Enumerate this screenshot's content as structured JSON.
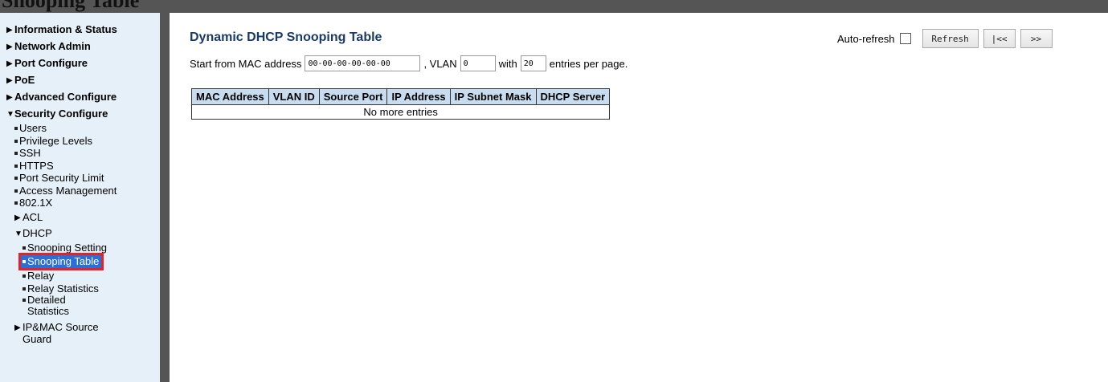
{
  "topbar": {
    "partial_title": "Snooping Table"
  },
  "sidebar": {
    "top_items": [
      {
        "label": "Information & Status"
      },
      {
        "label": "Network Admin"
      },
      {
        "label": "Port Configure"
      },
      {
        "label": "PoE"
      },
      {
        "label": "Advanced Configure"
      },
      {
        "label": "Security Configure"
      }
    ],
    "security_items": [
      "Users",
      "Privilege Levels",
      "SSH",
      "HTTPS",
      "Port Security Limit",
      "Access Management",
      "802.1X"
    ],
    "acl_label": "ACL",
    "dhcp_label": "DHCP",
    "dhcp_items": [
      "Snooping Setting",
      "Snooping Table",
      "Relay",
      "Relay Statistics"
    ],
    "dhcp_detailed": [
      "Detailed",
      "Statistics"
    ],
    "ipmac_label": [
      "IP&MAC Source",
      "Guard"
    ]
  },
  "main": {
    "title": "Dynamic DHCP Snooping Table",
    "auto_refresh_label": "Auto-refresh",
    "refresh_button": "Refresh",
    "first_button": "|<<",
    "next_button": ">>",
    "filter": {
      "start_label": "Start from MAC address",
      "mac_value": "00-00-00-00-00-00",
      "vlan_label": ", VLAN",
      "vlan_value": "0",
      "with_label": "with",
      "entries_value": "20",
      "per_page_label": "entries per page."
    },
    "table": {
      "headers": [
        "MAC Address",
        "VLAN ID",
        "Source Port",
        "IP Address",
        "IP Subnet Mask",
        "DHCP Server"
      ],
      "empty_message": "No more entries"
    }
  }
}
